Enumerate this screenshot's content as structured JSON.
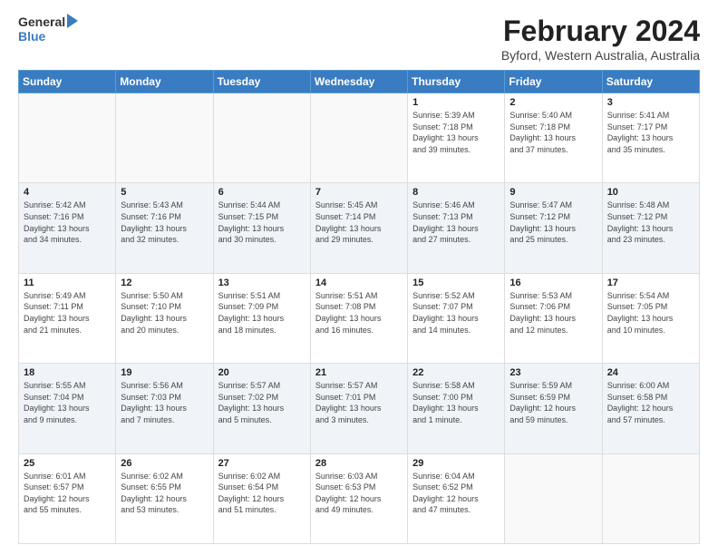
{
  "header": {
    "logo_general": "General",
    "logo_blue": "Blue",
    "main_title": "February 2024",
    "subtitle": "Byford, Western Australia, Australia"
  },
  "days_of_week": [
    "Sunday",
    "Monday",
    "Tuesday",
    "Wednesday",
    "Thursday",
    "Friday",
    "Saturday"
  ],
  "weeks": [
    [
      {
        "day": "",
        "info": ""
      },
      {
        "day": "",
        "info": ""
      },
      {
        "day": "",
        "info": ""
      },
      {
        "day": "",
        "info": ""
      },
      {
        "day": "1",
        "info": "Sunrise: 5:39 AM\nSunset: 7:18 PM\nDaylight: 13 hours\nand 39 minutes."
      },
      {
        "day": "2",
        "info": "Sunrise: 5:40 AM\nSunset: 7:18 PM\nDaylight: 13 hours\nand 37 minutes."
      },
      {
        "day": "3",
        "info": "Sunrise: 5:41 AM\nSunset: 7:17 PM\nDaylight: 13 hours\nand 35 minutes."
      }
    ],
    [
      {
        "day": "4",
        "info": "Sunrise: 5:42 AM\nSunset: 7:16 PM\nDaylight: 13 hours\nand 34 minutes."
      },
      {
        "day": "5",
        "info": "Sunrise: 5:43 AM\nSunset: 7:16 PM\nDaylight: 13 hours\nand 32 minutes."
      },
      {
        "day": "6",
        "info": "Sunrise: 5:44 AM\nSunset: 7:15 PM\nDaylight: 13 hours\nand 30 minutes."
      },
      {
        "day": "7",
        "info": "Sunrise: 5:45 AM\nSunset: 7:14 PM\nDaylight: 13 hours\nand 29 minutes."
      },
      {
        "day": "8",
        "info": "Sunrise: 5:46 AM\nSunset: 7:13 PM\nDaylight: 13 hours\nand 27 minutes."
      },
      {
        "day": "9",
        "info": "Sunrise: 5:47 AM\nSunset: 7:12 PM\nDaylight: 13 hours\nand 25 minutes."
      },
      {
        "day": "10",
        "info": "Sunrise: 5:48 AM\nSunset: 7:12 PM\nDaylight: 13 hours\nand 23 minutes."
      }
    ],
    [
      {
        "day": "11",
        "info": "Sunrise: 5:49 AM\nSunset: 7:11 PM\nDaylight: 13 hours\nand 21 minutes."
      },
      {
        "day": "12",
        "info": "Sunrise: 5:50 AM\nSunset: 7:10 PM\nDaylight: 13 hours\nand 20 minutes."
      },
      {
        "day": "13",
        "info": "Sunrise: 5:51 AM\nSunset: 7:09 PM\nDaylight: 13 hours\nand 18 minutes."
      },
      {
        "day": "14",
        "info": "Sunrise: 5:51 AM\nSunset: 7:08 PM\nDaylight: 13 hours\nand 16 minutes."
      },
      {
        "day": "15",
        "info": "Sunrise: 5:52 AM\nSunset: 7:07 PM\nDaylight: 13 hours\nand 14 minutes."
      },
      {
        "day": "16",
        "info": "Sunrise: 5:53 AM\nSunset: 7:06 PM\nDaylight: 13 hours\nand 12 minutes."
      },
      {
        "day": "17",
        "info": "Sunrise: 5:54 AM\nSunset: 7:05 PM\nDaylight: 13 hours\nand 10 minutes."
      }
    ],
    [
      {
        "day": "18",
        "info": "Sunrise: 5:55 AM\nSunset: 7:04 PM\nDaylight: 13 hours\nand 9 minutes."
      },
      {
        "day": "19",
        "info": "Sunrise: 5:56 AM\nSunset: 7:03 PM\nDaylight: 13 hours\nand 7 minutes."
      },
      {
        "day": "20",
        "info": "Sunrise: 5:57 AM\nSunset: 7:02 PM\nDaylight: 13 hours\nand 5 minutes."
      },
      {
        "day": "21",
        "info": "Sunrise: 5:57 AM\nSunset: 7:01 PM\nDaylight: 13 hours\nand 3 minutes."
      },
      {
        "day": "22",
        "info": "Sunrise: 5:58 AM\nSunset: 7:00 PM\nDaylight: 13 hours\nand 1 minute."
      },
      {
        "day": "23",
        "info": "Sunrise: 5:59 AM\nSunset: 6:59 PM\nDaylight: 12 hours\nand 59 minutes."
      },
      {
        "day": "24",
        "info": "Sunrise: 6:00 AM\nSunset: 6:58 PM\nDaylight: 12 hours\nand 57 minutes."
      }
    ],
    [
      {
        "day": "25",
        "info": "Sunrise: 6:01 AM\nSunset: 6:57 PM\nDaylight: 12 hours\nand 55 minutes."
      },
      {
        "day": "26",
        "info": "Sunrise: 6:02 AM\nSunset: 6:55 PM\nDaylight: 12 hours\nand 53 minutes."
      },
      {
        "day": "27",
        "info": "Sunrise: 6:02 AM\nSunset: 6:54 PM\nDaylight: 12 hours\nand 51 minutes."
      },
      {
        "day": "28",
        "info": "Sunrise: 6:03 AM\nSunset: 6:53 PM\nDaylight: 12 hours\nand 49 minutes."
      },
      {
        "day": "29",
        "info": "Sunrise: 6:04 AM\nSunset: 6:52 PM\nDaylight: 12 hours\nand 47 minutes."
      },
      {
        "day": "",
        "info": ""
      },
      {
        "day": "",
        "info": ""
      }
    ]
  ]
}
